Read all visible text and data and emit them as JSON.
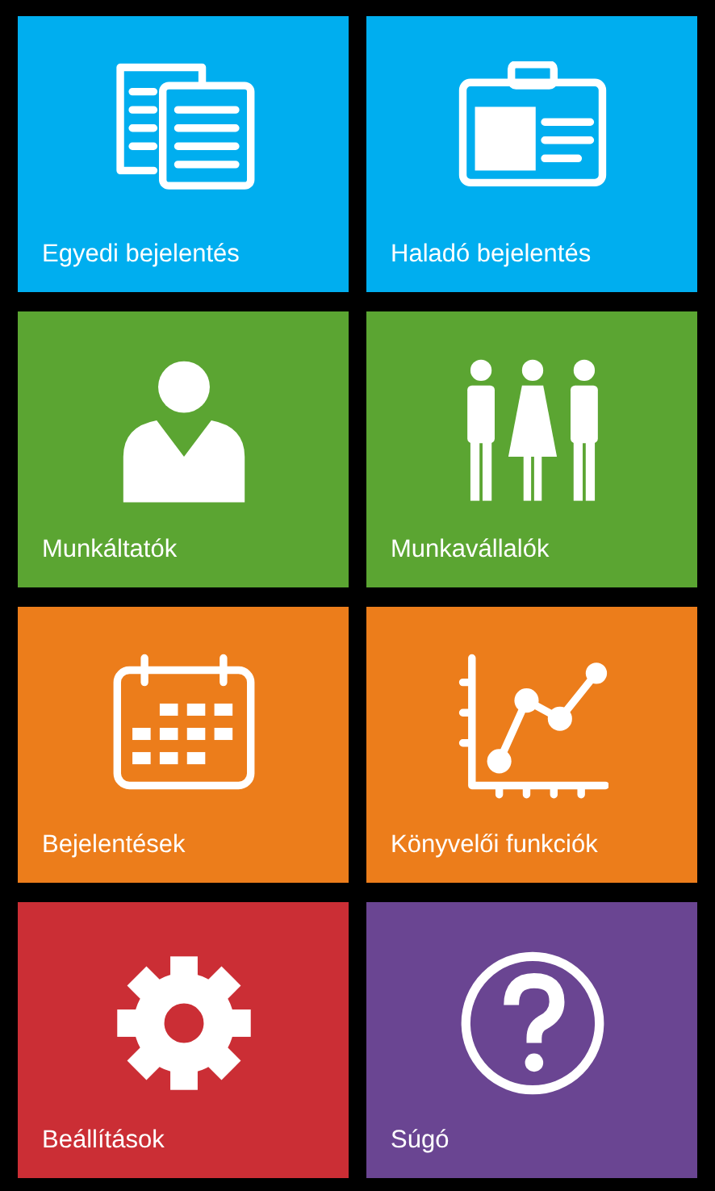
{
  "tiles": [
    {
      "label": "Egyedi bejelentés",
      "color": "#00aeef",
      "kind": "documents"
    },
    {
      "label": "Haladó bejelentés",
      "color": "#00aeef",
      "kind": "badge"
    },
    {
      "label": "Munkáltatók",
      "color": "#5ba532",
      "kind": "person"
    },
    {
      "label": "Munkavállalók",
      "color": "#5ba532",
      "kind": "people"
    },
    {
      "label": "Bejelentések",
      "color": "#ec7d1b",
      "kind": "calendar"
    },
    {
      "label": "Könyvelői funkciók",
      "color": "#ec7d1b",
      "kind": "chart"
    },
    {
      "label": "Beállítások",
      "color": "#cb2e35",
      "kind": "gear"
    },
    {
      "label": "Súgó",
      "color": "#6a4592",
      "kind": "help"
    }
  ]
}
